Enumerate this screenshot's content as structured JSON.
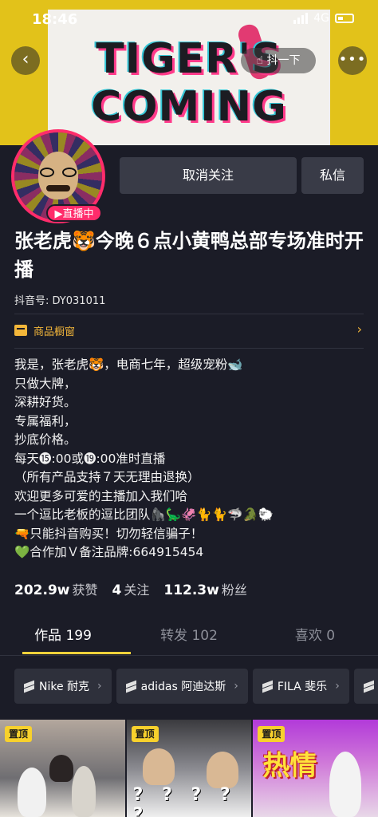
{
  "status_bar": {
    "time": "18:46",
    "network": "4G"
  },
  "cover": {
    "line1": "TIGER'S",
    "line2": "COMING"
  },
  "header": {
    "back_icon": "chevron-left-icon",
    "shake_label": "抖一下",
    "more_icon": "ellipsis-icon"
  },
  "profile": {
    "live_badge": "▶直播中",
    "unfollow_label": "取消关注",
    "message_label": "私信",
    "nickname": "张老虎🐯今晚６点小黄鸭总部专场准时开播",
    "douyin_id": "抖音号: DY031011",
    "shop_label": "商品橱窗",
    "shop_arrow": "›"
  },
  "bio": {
    "lines": [
      "我是，张老虎🐯，电商七年，超级宠粉🐋",
      "只做大牌，",
      "深耕好货。",
      "专属福利，",
      "抄底价格。",
      "每天⓯:00或⓳:00准时直播",
      "（所有产品支持７天无理由退换）",
      "欢迎更多可爱的主播加入我们哈",
      "一个逗比老板的逗比团队🦍🦕🦑🐈🐈🦈🐊🐑",
      "🔫只能抖音购买！切勿轻信骗子！",
      "💚合作加Ｖ备注品牌:664915454"
    ]
  },
  "stats": [
    {
      "num": "202.9w",
      "label": "获赞"
    },
    {
      "num": "4",
      "label": "关注"
    },
    {
      "num": "112.3w",
      "label": "粉丝"
    }
  ],
  "tabs": [
    {
      "label": "作品 199",
      "active": true
    },
    {
      "label": "转发 102",
      "active": false
    },
    {
      "label": "喜欢 0",
      "active": false
    }
  ],
  "chips": [
    {
      "label": "Nike 耐克",
      "arrow": "›"
    },
    {
      "label": "adidas 阿迪达斯",
      "arrow": "›"
    },
    {
      "label": "FILA 斐乐",
      "arrow": "›"
    },
    {
      "label": "",
      "arrow": ""
    }
  ],
  "videos": [
    {
      "pin": "置顶"
    },
    {
      "pin": "置顶",
      "overlay": "? ? ? ? ?"
    },
    {
      "pin": "置顶",
      "overlay": "热情"
    }
  ],
  "colors": {
    "background": "#1b1c27",
    "accent_yellow": "#f1d23b",
    "live_pink": "#ff2c6b",
    "shop_gold": "#f3b63a"
  }
}
